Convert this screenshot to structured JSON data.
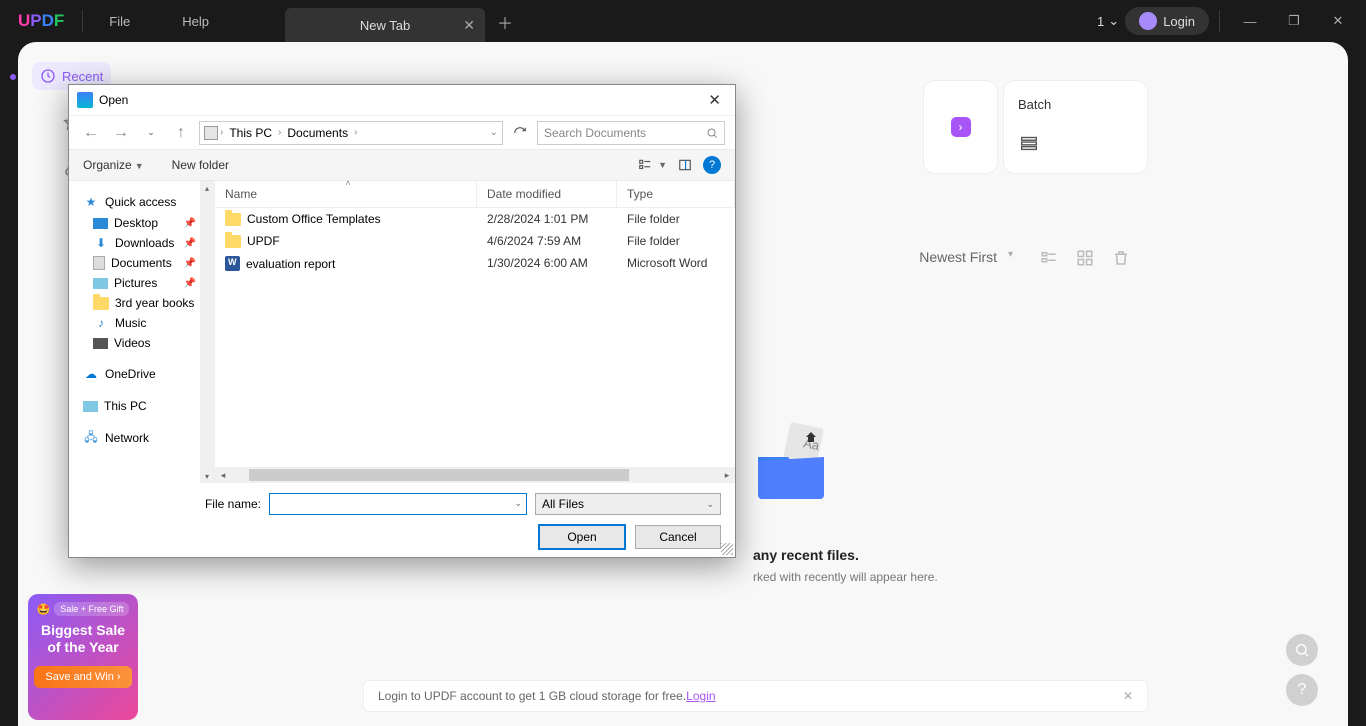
{
  "titlebar": {
    "menu_file": "File",
    "menu_help": "Help",
    "tab_label": "New Tab",
    "tab_count": "1",
    "login": "Login"
  },
  "leftrail": {
    "recent": "Recent"
  },
  "cards": {
    "batch": "Batch"
  },
  "rightTools": {
    "sort": "Newest First"
  },
  "empty": {
    "title": "any recent files.",
    "sub": "rked with recently will appear here."
  },
  "promo": {
    "badge": "Sale + Free Gift",
    "line1": "Biggest Sale",
    "line2": "of the Year",
    "btn": "Save and Win"
  },
  "banner": {
    "text": "Login to UPDF account to get 1 GB cloud storage for free.",
    "link": "Login"
  },
  "dialog": {
    "title": "Open",
    "path_pc": "This PC",
    "path_docs": "Documents",
    "search_placeholder": "Search Documents",
    "organize": "Organize",
    "new_folder": "New folder",
    "columns": {
      "name": "Name",
      "date": "Date modified",
      "type": "Type"
    },
    "sidebar": {
      "quick": "Quick access",
      "desktop": "Desktop",
      "downloads": "Downloads",
      "documents": "Documents",
      "pictures": "Pictures",
      "books": "3rd year books",
      "music": "Music",
      "videos": "Videos",
      "onedrive": "OneDrive",
      "thispc": "This PC",
      "network": "Network"
    },
    "files": [
      {
        "name": "Custom Office Templates",
        "date": "2/28/2024 1:01 PM",
        "type": "File folder",
        "kind": "folder"
      },
      {
        "name": "UPDF",
        "date": "4/6/2024 7:59 AM",
        "type": "File folder",
        "kind": "folder"
      },
      {
        "name": "evaluation report",
        "date": "1/30/2024 6:00 AM",
        "type": "Microsoft Word",
        "kind": "word"
      }
    ],
    "filename_label": "File name:",
    "filename_value": "",
    "filter": "All Files",
    "open_btn": "Open",
    "cancel_btn": "Cancel"
  }
}
